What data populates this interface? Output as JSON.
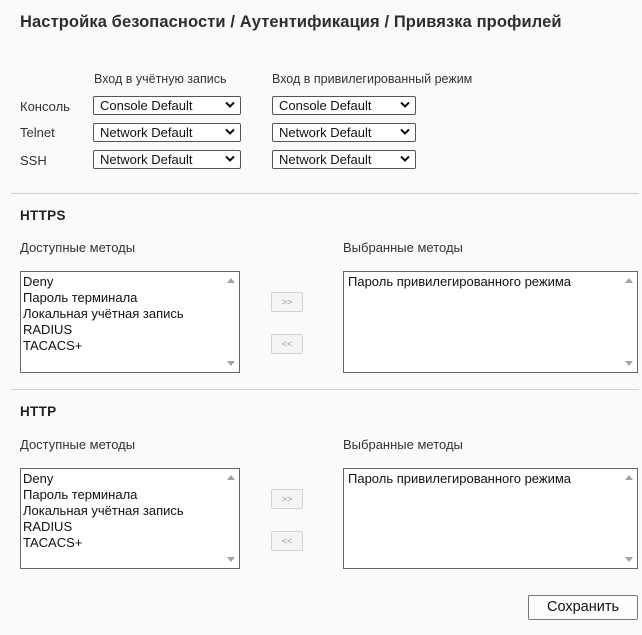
{
  "page": {
    "title": "Настройка безопасности / Аутентификация / Привязка профилей"
  },
  "profiles": {
    "col_login": "Вход в учётную запись",
    "col_privileged": "Вход в привилегированный режим",
    "rows": [
      {
        "label": "Консоль",
        "login": "Console Default",
        "privileged": "Console Default"
      },
      {
        "label": "Telnet",
        "login": "Network Default",
        "privileged": "Network Default"
      },
      {
        "label": "SSH",
        "login": "Network Default",
        "privileged": "Network Default"
      }
    ]
  },
  "https": {
    "title": "HTTPS",
    "available_label": "Доступные методы",
    "selected_label": "Выбранные методы",
    "available": [
      "Deny",
      "Пароль терминала",
      "Локальная учётная запись",
      "RADIUS",
      "TACACS+"
    ],
    "selected": [
      "Пароль привилегированного режима"
    ],
    "add_label": ">>",
    "remove_label": "<<"
  },
  "http": {
    "title": "HTTP",
    "available_label": "Доступные методы",
    "selected_label": "Выбранные методы",
    "available": [
      "Deny",
      "Пароль терминала",
      "Локальная учётная запись",
      "RADIUS",
      "TACACS+"
    ],
    "selected": [
      "Пароль привилегированного режима"
    ],
    "add_label": ">>",
    "remove_label": "<<"
  },
  "actions": {
    "save_label": "Сохранить"
  },
  "icons": {
    "select_arrow": "chevron-down-icon",
    "scroll_up": "scroll-up-arrow-icon",
    "scroll_down": "scroll-down-arrow-icon"
  }
}
